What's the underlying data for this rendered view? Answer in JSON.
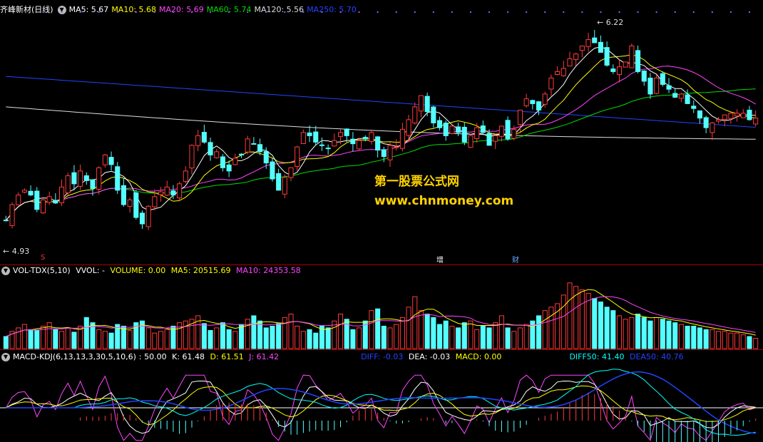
{
  "main_header": {
    "title": "齐峰新材(日线)",
    "ma": [
      {
        "label": "MA5: 5.67",
        "color": "#ffffff"
      },
      {
        "label": "MA10: 5.68",
        "color": "#ffff00"
      },
      {
        "label": "MA20: 5.69",
        "color": "#ff44ff"
      },
      {
        "label": "MA60: 5.74",
        "color": "#00dd00"
      },
      {
        "label": "MA120: 5.56",
        "color": "#dddddd"
      },
      {
        "label": "MA250: 5.70",
        "color": "#2244ff"
      }
    ]
  },
  "vol_header": {
    "name": "VOL-TDX(5,10)",
    "vvol": "VVOL: -",
    "volume": {
      "label": "VOLUME: 0.00",
      "color": "#ffff00"
    },
    "ma5": {
      "label": "MA5: 20515.69",
      "color": "#ffff00"
    },
    "ma10": {
      "label": "MA10: 24353.58",
      "color": "#ff44ff"
    }
  },
  "macd_header": {
    "name": "MACD-KDJ(6,13,13,3,30,5,10,6)",
    "val": ": 50.00",
    "k": {
      "label": "K: 61.48",
      "color": "#ffffff"
    },
    "d": {
      "label": "D: 61.51",
      "color": "#ffff00"
    },
    "j": {
      "label": "J: 61.42",
      "color": "#ff44ff"
    },
    "diff": {
      "label": "DIFF: -0.03",
      "color": "#2244ff"
    },
    "dea": {
      "label": "DEA: -0.03",
      "color": "#ffffff"
    },
    "macd": {
      "label": "MACD: 0.00",
      "color": "#ffff00"
    },
    "diff50": {
      "label": "DIFF50: 41.40",
      "color": "#00ffff"
    },
    "dea50": {
      "label": "DEA50: 40.76",
      "color": "#2244ff"
    }
  },
  "watermark": {
    "line1": "第一股票公式网",
    "line2": "www.chnmoney.com"
  },
  "markers": {
    "s": "S",
    "zeng": "增",
    "cai": "财"
  },
  "chart_data": {
    "type": "candlestick",
    "price_high_label": "6.22",
    "price_low_label": "4.93",
    "ylim": [
      4.85,
      6.3
    ],
    "colors": {
      "up": "#ff3b3b",
      "down": "#54ffff",
      "ma5": "#ffffff",
      "ma10": "#ffff00",
      "ma20": "#ff44ff",
      "ma60": "#00dd00",
      "ma120": "#dddddd",
      "ma250": "#2244ff"
    },
    "closes": [
      5.03,
      5.13,
      5.19,
      5.22,
      5.19,
      5.1,
      5.16,
      5.18,
      5.14,
      5.24,
      5.31,
      5.26,
      5.34,
      5.28,
      5.23,
      5.36,
      5.44,
      5.38,
      5.22,
      5.13,
      5.16,
      5.05,
      5.01,
      5.12,
      5.18,
      5.21,
      5.24,
      5.19,
      5.26,
      5.34,
      5.5,
      5.56,
      5.52,
      5.44,
      5.46,
      5.36,
      5.34,
      5.42,
      5.44,
      5.54,
      5.51,
      5.46,
      5.39,
      5.29,
      5.22,
      5.3,
      5.36,
      5.49,
      5.58,
      5.56,
      5.52,
      5.5,
      5.48,
      5.53,
      5.58,
      5.56,
      5.51,
      5.53,
      5.54,
      5.58,
      5.47,
      5.43,
      5.5,
      5.49,
      5.6,
      5.66,
      5.74,
      5.81,
      5.71,
      5.64,
      5.61,
      5.56,
      5.62,
      5.58,
      5.52,
      5.56,
      5.61,
      5.58,
      5.5,
      5.56,
      5.62,
      5.54,
      5.6,
      5.72,
      5.79,
      5.76,
      5.72,
      5.82,
      5.92,
      5.96,
      5.98,
      6.04,
      6.07,
      6.12,
      6.16,
      6.14,
      6.08,
      6.0,
      5.96,
      5.99,
      6.02,
      6.12,
      5.96,
      5.9,
      5.82,
      5.92,
      5.88,
      5.85,
      5.8,
      5.82,
      5.76,
      5.73,
      5.67,
      5.61,
      5.64,
      5.66,
      5.69,
      5.7,
      5.7,
      5.7,
      5.66,
      5.67
    ],
    "volumes": [
      14000,
      20000,
      24000,
      28000,
      22000,
      21000,
      26000,
      30000,
      22000,
      20000,
      24000,
      19000,
      26000,
      36000,
      30000,
      22000,
      20000,
      18000,
      28000,
      26000,
      21000,
      30000,
      32000,
      24000,
      18000,
      20000,
      22000,
      26000,
      30000,
      32000,
      34000,
      38000,
      29000,
      21000,
      24000,
      30000,
      22000,
      20000,
      28000,
      34000,
      38000,
      32000,
      24000,
      26000,
      29000,
      36000,
      40000,
      26000,
      20000,
      22000,
      18000,
      26000,
      24000,
      32000,
      40000,
      34000,
      22000,
      24000,
      32000,
      44000,
      46000,
      26000,
      24000,
      28000,
      36000,
      48000,
      60000,
      44000,
      40000,
      36000,
      28000,
      32000,
      26000,
      24000,
      30000,
      32000,
      22000,
      26000,
      24000,
      30000,
      38000,
      24000,
      20000,
      24000,
      28000,
      32000,
      38000,
      44000,
      48000,
      52000,
      62000,
      76000,
      72000,
      68000,
      64000,
      58000,
      54000,
      48000,
      44000,
      38000,
      34000,
      36000,
      40000,
      36000,
      32000,
      36000,
      34000,
      32000,
      30000,
      28000,
      26000,
      26000,
      24000,
      22000,
      22000,
      20000,
      20000,
      18000,
      18000,
      16000,
      14000,
      12000
    ],
    "vol_max": 80000,
    "macd_ylim": [
      -60,
      60
    ]
  }
}
